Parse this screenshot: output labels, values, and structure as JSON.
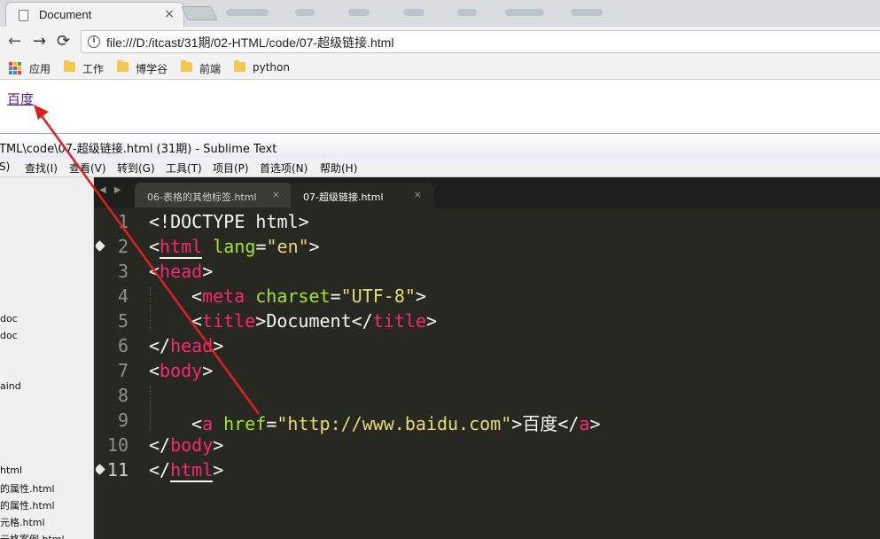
{
  "browser": {
    "tab": {
      "title": "Document",
      "close": "×"
    },
    "nav": {
      "back": "←",
      "forward": "→",
      "reload": "⟳"
    },
    "address": {
      "url": "file:///D:/itcast/31期/02-HTML/code/07-超级链接.html",
      "info": "i"
    },
    "bookmarks": [
      {
        "label": "应用",
        "icon": "apps-grid-icon"
      },
      {
        "label": "工作",
        "icon": "folder-icon"
      },
      {
        "label": "博学谷",
        "icon": "folder-icon"
      },
      {
        "label": "前端",
        "icon": "folder-icon"
      },
      {
        "label": "python",
        "icon": "folder-icon"
      }
    ],
    "page": {
      "link_text": "百度"
    }
  },
  "editor": {
    "title": "TML\\code\\07-超级链接.html (31期) - Sublime Text",
    "menu": [
      "S)",
      "查找(I)",
      "查看(V)",
      "转到(G)",
      "工具(T)",
      "项目(P)",
      "首选项(N)",
      "帮助(H)"
    ],
    "sidebar_items": [
      "doc",
      "doc",
      "aind",
      "html",
      "的属性.html",
      "的属性.html",
      "元格.html",
      "元格案例.html"
    ],
    "tabs": [
      {
        "label": "06-表格的其他标签.html",
        "close": "×",
        "active": false
      },
      {
        "label": "07-超级链接.html",
        "close": "×",
        "active": true
      }
    ],
    "tab_arrows": "◀ ▶",
    "line_numbers": [
      "1",
      "2",
      "3",
      "4",
      "5",
      "6",
      "7",
      "8",
      "9",
      "10",
      "11"
    ],
    "current_line": "11",
    "code": {
      "l1": {
        "text": "<!DOCTYPE html>"
      },
      "l2": {
        "lt": "<",
        "tag": "html",
        "attr": "lang",
        "eq": "=",
        "val": "\"en\"",
        "gt": ">"
      },
      "l3": {
        "lt": "<",
        "tag": "head",
        "gt": ">"
      },
      "l4": {
        "lt": "<",
        "tag": "meta",
        "attr": "charset",
        "eq": "=",
        "val": "\"UTF-8\"",
        "gt": ">"
      },
      "l5": {
        "lt": "<",
        "tag": "title",
        "gt": ">",
        "text": "Document",
        "clt": "</",
        "ctag": "title",
        "cgt": ">"
      },
      "l6": {
        "lt": "</",
        "tag": "head",
        "gt": ">"
      },
      "l7": {
        "lt": "<",
        "tag": "body",
        "gt": ">"
      },
      "l9": {
        "lt": "<",
        "tag": "a",
        "attr": "href",
        "eq": "=",
        "val": "\"http://www.baidu.com\"",
        "gt": ">",
        "text": "百度",
        "clt": "</",
        "ctag": "a",
        "cgt": ">"
      },
      "l10": {
        "lt": "</",
        "tag": "body",
        "gt": ">"
      },
      "l11": {
        "lt": "</",
        "tag": "html",
        "gt": ">"
      }
    }
  },
  "colors": {
    "editor_bg": "#272822",
    "tag": "#f92672",
    "attribute": "#a6e22e",
    "string": "#e6db74",
    "link": "#551a8b",
    "arrow": "#e02020"
  }
}
